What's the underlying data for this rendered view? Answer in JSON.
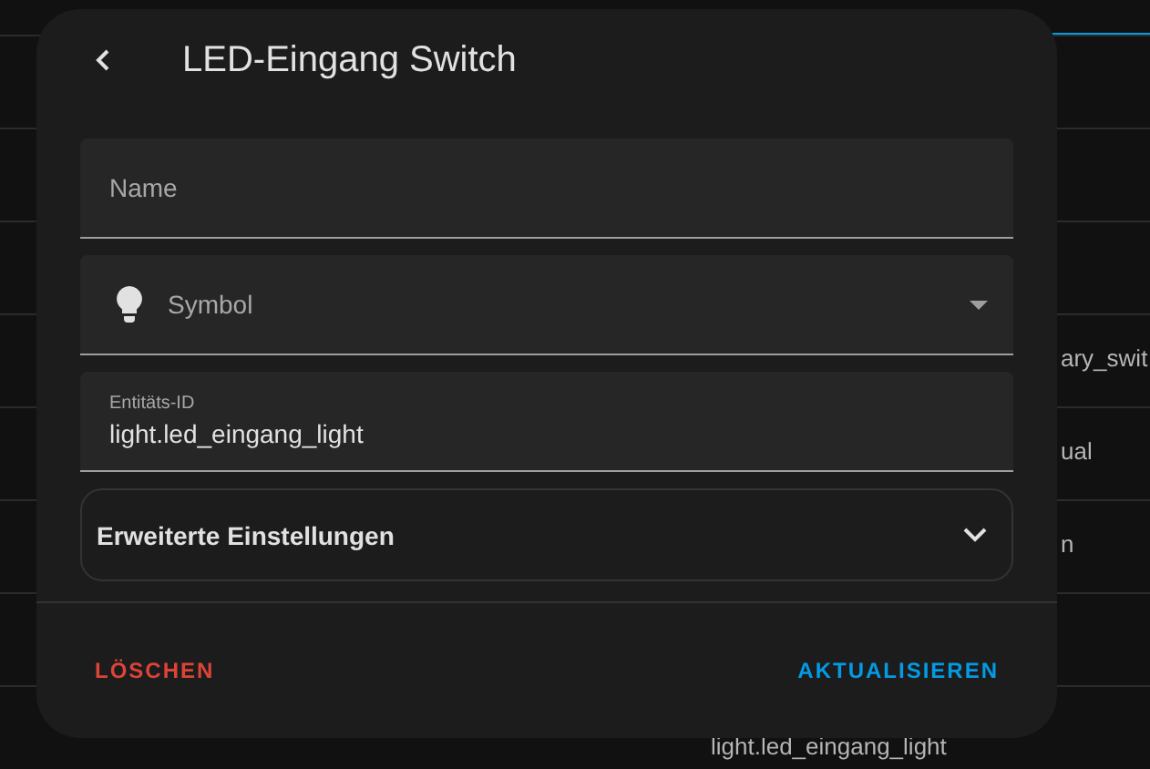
{
  "background_table": {
    "rows": [
      {
        "text": "ary_swit"
      },
      {
        "text": "ual"
      },
      {
        "text": "n"
      }
    ],
    "bottom_text": "light.led_eingang_light"
  },
  "dialog": {
    "title": "LED-Eingang Switch",
    "fields": [
      {
        "kind": "text",
        "label": "Name"
      },
      {
        "kind": "select",
        "label": "Symbol"
      },
      {
        "kind": "value",
        "label": "Entitäts-ID",
        "value": "light.led_eingang_light"
      }
    ],
    "advanced": {
      "label": "Erweiterte Einstellungen",
      "expanded": false
    },
    "buttons": {
      "delete": "LÖSCHEN",
      "update": "AKTUALISIEREN"
    }
  }
}
